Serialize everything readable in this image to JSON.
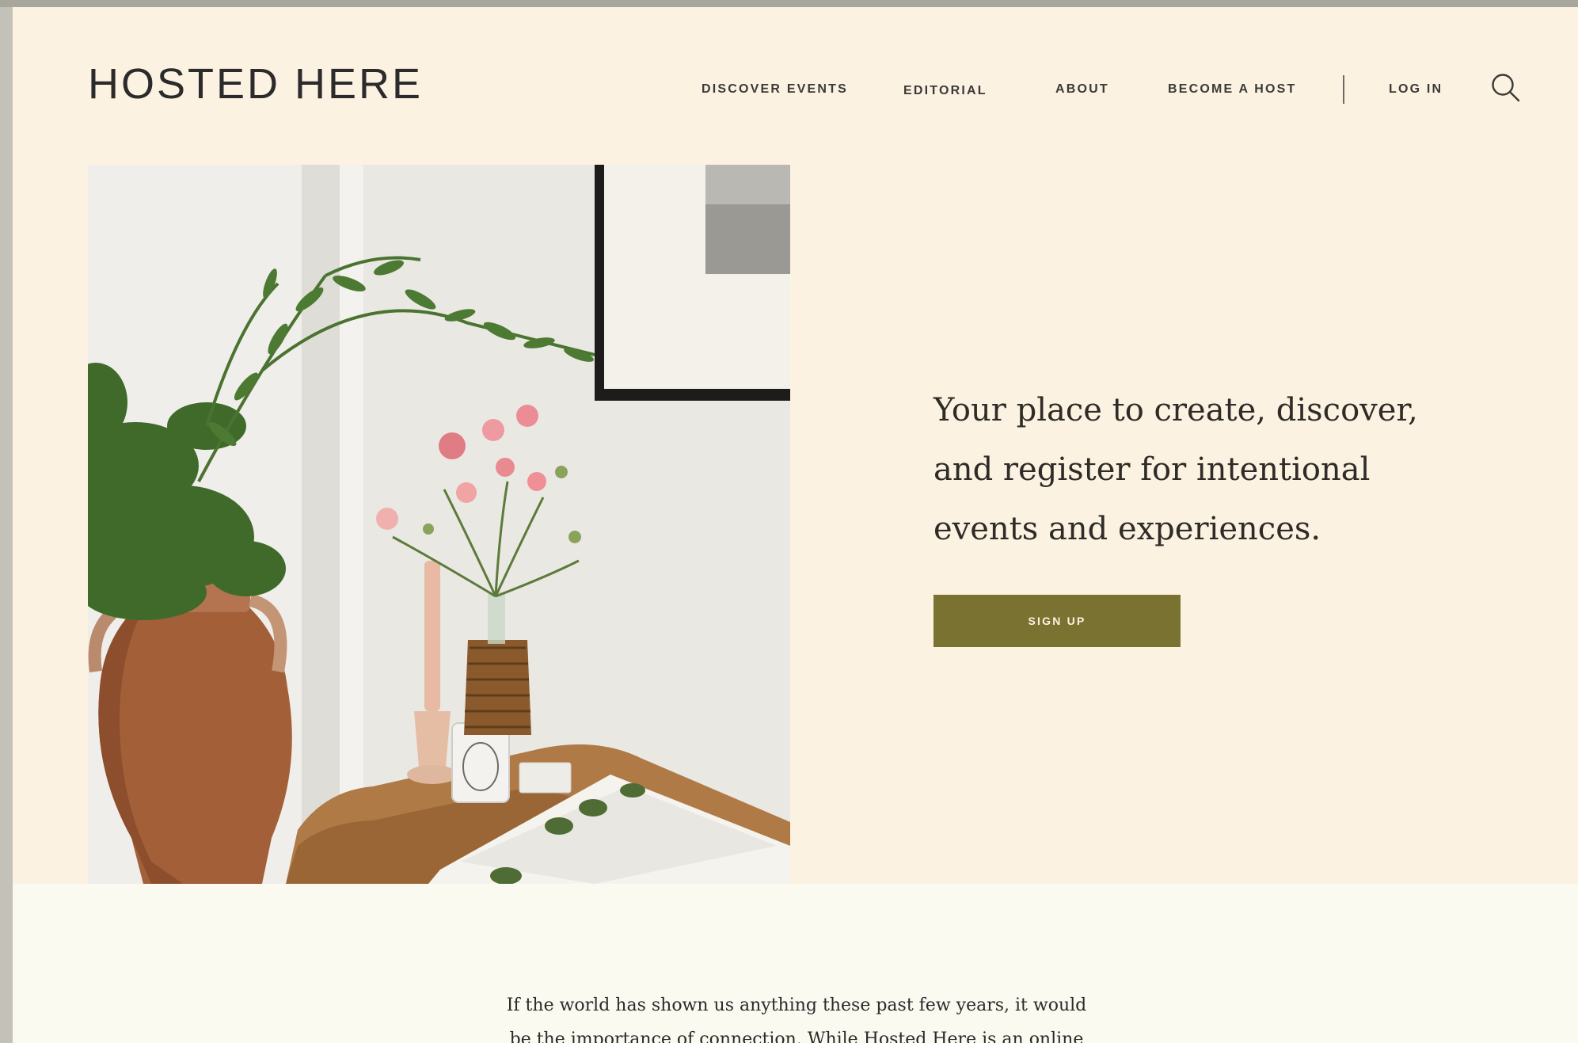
{
  "brand": {
    "logo_text": "HOSTED HERE"
  },
  "nav": {
    "items": [
      {
        "label": "DISCOVER EVENTS"
      },
      {
        "label": "EDITORIAL"
      },
      {
        "label": "ABOUT"
      },
      {
        "label": "BECOME A HOST"
      }
    ],
    "login_label": "LOG IN",
    "search_icon": "search-icon"
  },
  "hero": {
    "tagline": "Your place to create, discover, and register for intentional events and experiences.",
    "signup_label": "SIGN UP",
    "image": "photo-vase-greenery-flowers-candle-table"
  },
  "intro": {
    "text": "If the world has shown us anything these past few years, it would be the importance of connection. While Hosted Here is an online"
  },
  "colors": {
    "page_bg": "#fcf2e2",
    "intro_bg": "#fbfaf1",
    "accent": "#7a7231",
    "text": "#2b2b2b"
  }
}
